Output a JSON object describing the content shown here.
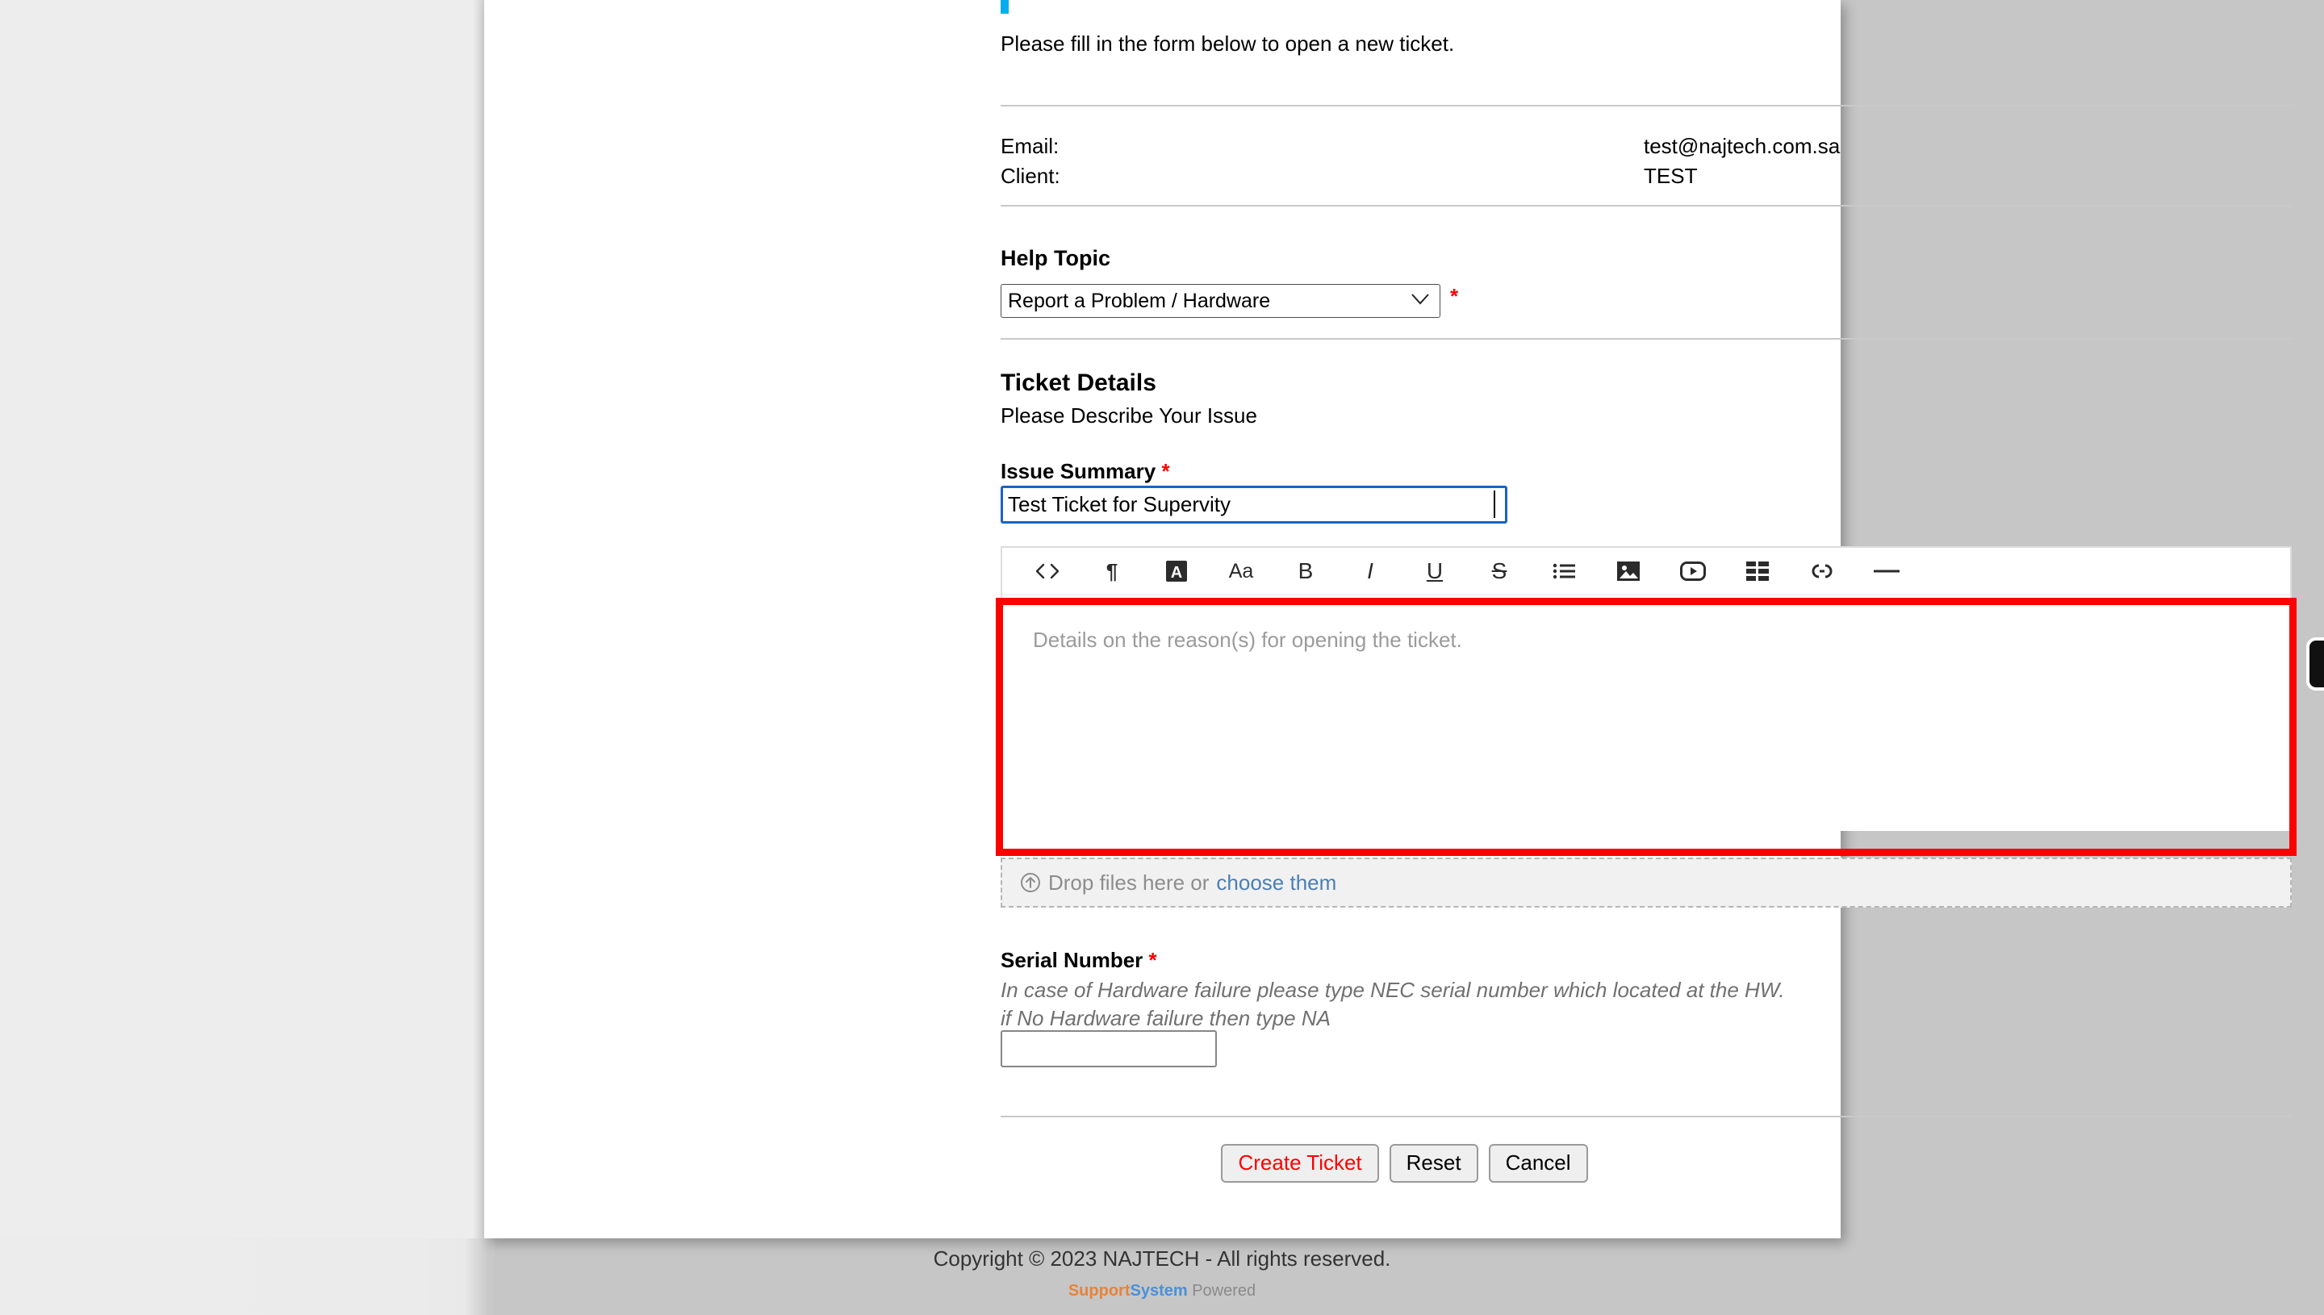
{
  "page": {
    "intro_text": "Please fill in the form below to open a new ticket."
  },
  "user_info": {
    "email_label": "Email:",
    "email_value": "test@najtech.com.sa",
    "client_label": "Client:",
    "client_value": "TEST"
  },
  "help_topic": {
    "title": "Help Topic",
    "selected": "Report a Problem / Hardware",
    "options": [
      "Report a Problem / Hardware"
    ],
    "required_marker": "*"
  },
  "ticket_details": {
    "title": "Ticket Details",
    "subtitle": "Please Describe Your Issue",
    "issue_summary_label": "Issue Summary",
    "issue_summary_required": "*",
    "issue_summary_value": "Test Ticket for Supervity",
    "editor_placeholder": "Details on the reason(s) for opening the ticket."
  },
  "editor_toolbar": {
    "buttons": [
      {
        "name": "code-icon",
        "glyph": "<>"
      },
      {
        "name": "paragraph-icon",
        "glyph": "¶"
      },
      {
        "name": "text-color-icon",
        "glyph": "A"
      },
      {
        "name": "font-size-icon",
        "glyph": "Aa"
      },
      {
        "name": "bold-icon",
        "glyph": "B"
      },
      {
        "name": "italic-icon",
        "glyph": "I"
      },
      {
        "name": "underline-icon",
        "glyph": "U"
      },
      {
        "name": "strikethrough-icon",
        "glyph": "S"
      },
      {
        "name": "bullet-list-icon",
        "glyph": "list"
      },
      {
        "name": "image-icon",
        "glyph": "image"
      },
      {
        "name": "video-icon",
        "glyph": "video"
      },
      {
        "name": "table-icon",
        "glyph": "table"
      },
      {
        "name": "link-icon",
        "glyph": "link"
      },
      {
        "name": "horizontal-rule-icon",
        "glyph": "—"
      }
    ]
  },
  "dropzone": {
    "icon": "upload-circle-icon",
    "text": "Drop files here or",
    "link_text": "choose them"
  },
  "serial_number": {
    "label": "Serial Number",
    "required_marker": "*",
    "hint_line_1": "In case of Hardware failure please type NEC serial number which located at the HW.",
    "hint_line_2": "if No Hardware failure then type NA",
    "value": "",
    "placeholder": ""
  },
  "actions": {
    "create_label": "Create Ticket",
    "reset_label": "Reset",
    "cancel_label": "Cancel"
  },
  "footer": {
    "copyright": "Copyright © 2023 NAJTECH - All rights reserved.",
    "brand_support": "Support",
    "brand_system": "System",
    "brand_powered": "Powered"
  },
  "colors": {
    "required_star": "#ff0000",
    "highlight_ring": "#fd0000",
    "focus_border": "#1a63c4",
    "link": "#4a7fb5",
    "create_button_text": "#ff0000",
    "brand_support": "#e8833a",
    "brand_system": "#4a90d9",
    "page_background": "#c6c6c6"
  }
}
